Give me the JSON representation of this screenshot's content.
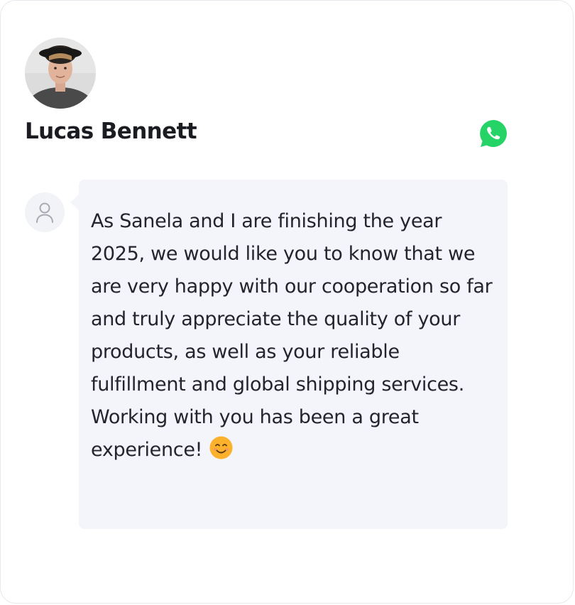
{
  "review": {
    "author_name": "Lucas Bennett",
    "message": "As Sanela and I are finishing the year 2025, we would like you to know that we are very happy with our cooperation so far and truly appreciate the quality of your products, as well as your reliable fulfillment and global shipping services. Working with you has been a great experience!",
    "message_emoji": "smiling-face-emoji"
  },
  "icons": {
    "social": "whatsapp-icon",
    "avatar_placeholder": "user-icon"
  },
  "colors": {
    "whatsapp_green": "#25d366",
    "bubble_background": "#f4f5fa",
    "name_text": "#1b1c22",
    "message_text": "#23242c",
    "emoji_yellow": "#fbb12c"
  }
}
